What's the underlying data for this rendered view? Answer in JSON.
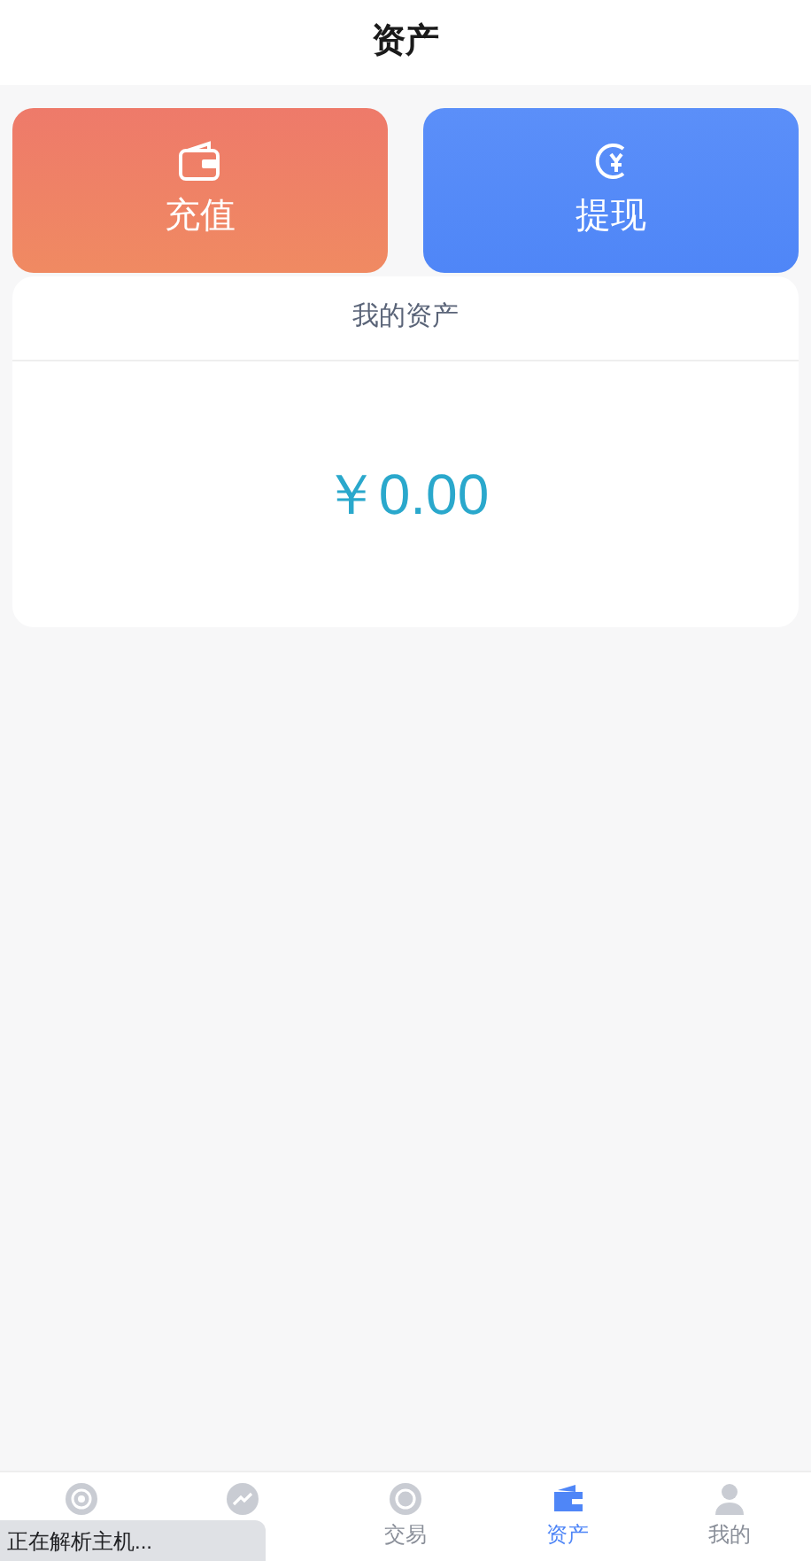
{
  "header": {
    "title": "资产"
  },
  "actions": [
    {
      "kind": "recharge",
      "label": "充值"
    },
    {
      "kind": "withdraw",
      "label": "提现"
    }
  ],
  "assets": {
    "title": "我的资产",
    "amount": "￥0.00"
  },
  "tabs": [
    {
      "selected": false
    },
    {
      "selected": false
    },
    {
      "label": "交易",
      "selected": false
    },
    {
      "label": "资产",
      "selected": true
    },
    {
      "label": "我的",
      "selected": false
    }
  ],
  "status_overlay": {
    "text": "正在解析主机..."
  }
}
